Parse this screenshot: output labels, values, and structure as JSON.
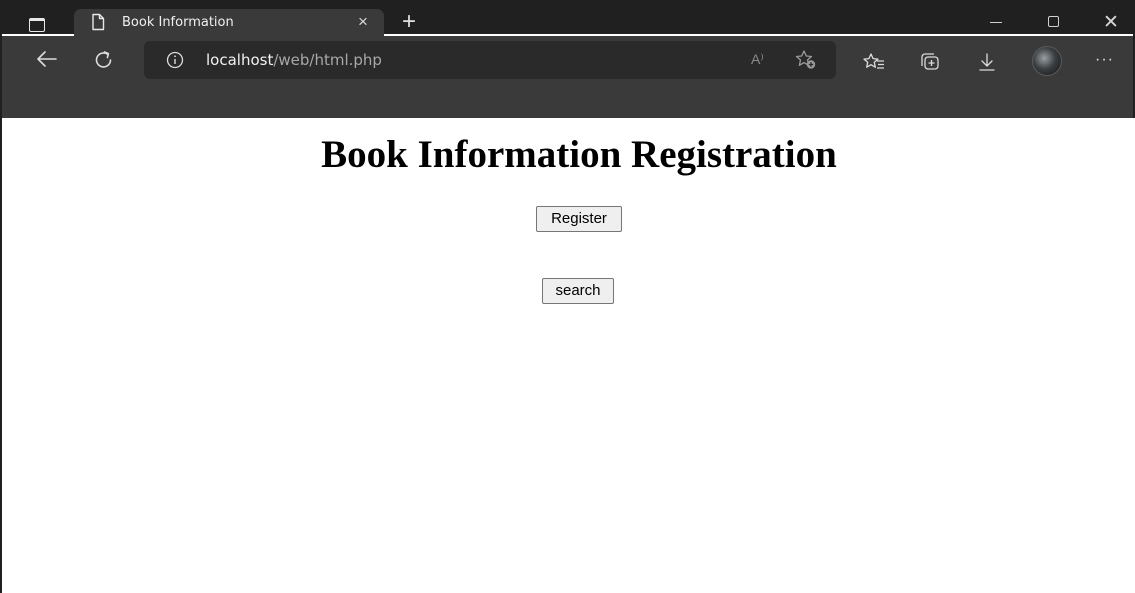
{
  "browser": {
    "tab": {
      "title": "Book Information",
      "close_glyph": "×"
    },
    "new_tab_glyph": "+",
    "window_controls": {
      "close_glyph": "✕"
    },
    "address_bar": {
      "host": "localhost",
      "path": "/web/html.php",
      "read_aloud_glyph": "A⁾"
    },
    "more_glyph": "···",
    "icons": [
      "tab-actions-icon",
      "page-icon",
      "back-icon",
      "reload-icon",
      "info-icon",
      "read-aloud-icon",
      "add-favorite-icon",
      "favorites-icon",
      "collections-icon",
      "download-icon",
      "profile-avatar",
      "more-icon"
    ]
  },
  "page": {
    "title": "Book Information Registration",
    "register_label": "Register",
    "search_label": "search"
  },
  "colors": {
    "tab_strip": "#202020",
    "toolbar": "#3a3a3a",
    "omnibox": "#2a2a2a",
    "button_bg": "#efefef"
  }
}
